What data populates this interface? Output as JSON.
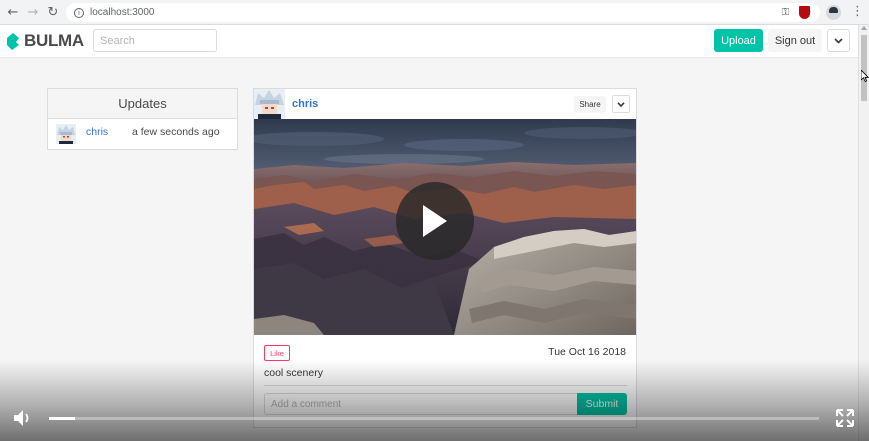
{
  "browser": {
    "url": "localhost:3000",
    "icons": [
      "back-icon",
      "forward-icon",
      "reload-icon",
      "info-icon",
      "key-icon",
      "star-icon",
      "shield-extension-icon",
      "profile-avatar-icon",
      "menu-icon"
    ]
  },
  "navbar": {
    "brand": "BULMA",
    "search_placeholder": "Search",
    "upload_label": "Upload",
    "signout_label": "Sign out",
    "brand_color": "#00c4a7"
  },
  "updates": {
    "title": "Updates",
    "items": [
      {
        "user": "chris",
        "time": "a few seconds ago"
      }
    ]
  },
  "post": {
    "user": "chris",
    "share_label": "Share",
    "like_label": "Like",
    "date": "Tue Oct 16 2018",
    "caption": "cool scenery",
    "comment_placeholder": "Add a comment",
    "submit_label": "Submit"
  },
  "player": {
    "progress": 0.034,
    "icons": [
      "volume-icon",
      "fullscreen-icon"
    ]
  },
  "colors": {
    "primary": "#00c4a7",
    "link": "#3273dc",
    "danger": "#ff3860"
  }
}
